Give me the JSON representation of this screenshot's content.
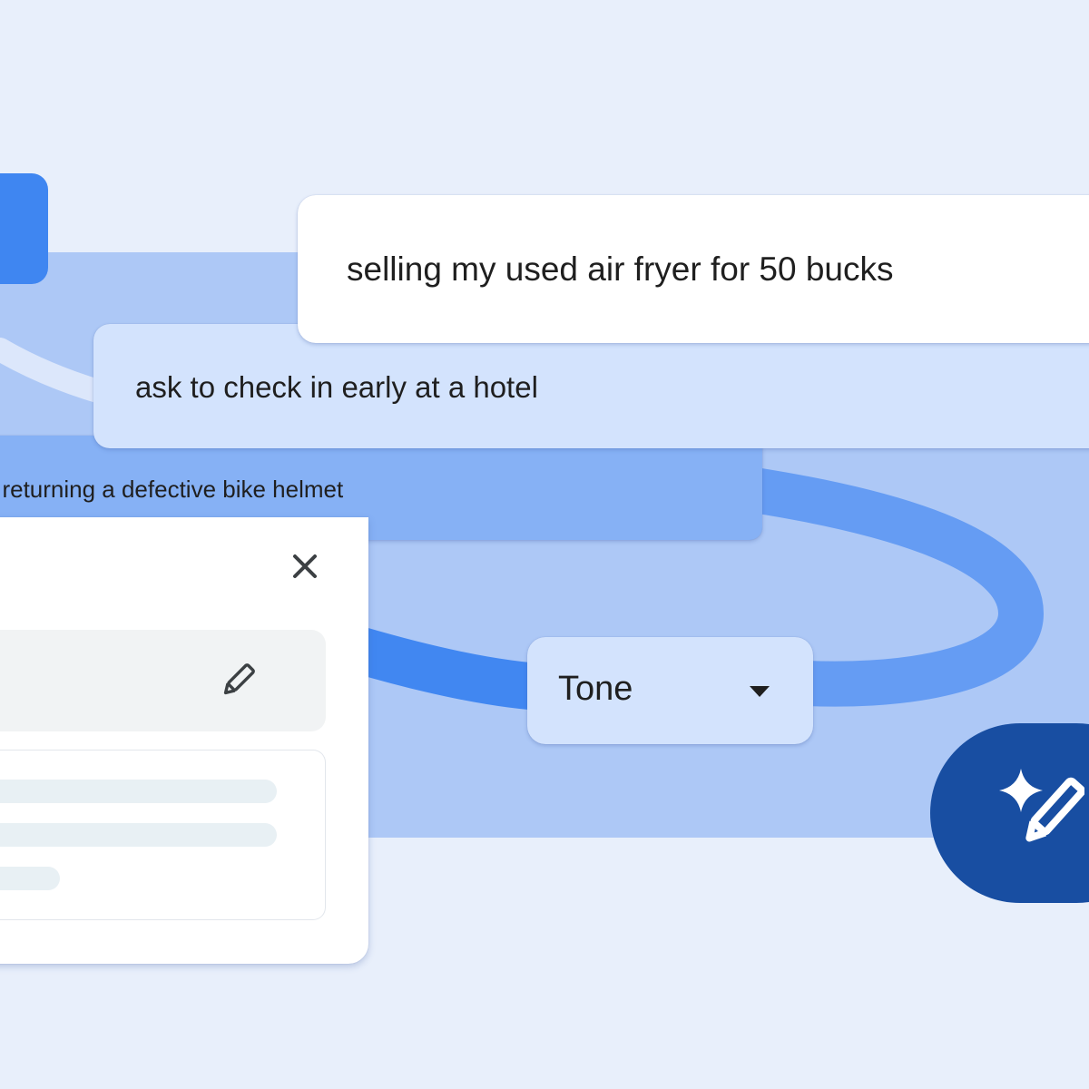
{
  "colors": {
    "page_background": "#e8effb",
    "panel_background": "#adc8f6",
    "ring_stroke": "#659cf3",
    "ring_stroke_left": "#4187f1",
    "ring_inner_light": "#dce7fb",
    "card_white": "#ffffff",
    "card_light_blue": "#d3e3fd",
    "card_mid_blue": "#86b1f5",
    "sparkle_tab": "#3f86f1",
    "fab_dark_blue": "#184ea2",
    "prompt_box_grey": "#f1f3f4",
    "skeleton_line": "#e8f0f4",
    "text_primary": "#1f1f1f",
    "icon_dark": "#3c4043"
  },
  "suggestions": {
    "top": "selling my used air fryer for 50 bucks",
    "middle": "ask to check in early at a hotel",
    "lower": "t returning a defective bike helmet"
  },
  "tone_dropdown": {
    "label": "Tone"
  },
  "dialog": {
    "result_lines": [
      {
        "fill": 0.87
      },
      {
        "fill": 0.87
      },
      {
        "fill": 0.3
      }
    ]
  },
  "icons": {
    "sparkle_tab": "sparkle-icon",
    "close": "close-icon",
    "edit": "pencil-icon",
    "tone_caret": "caret-down-icon",
    "fab": "sparkle-pen-icon"
  }
}
